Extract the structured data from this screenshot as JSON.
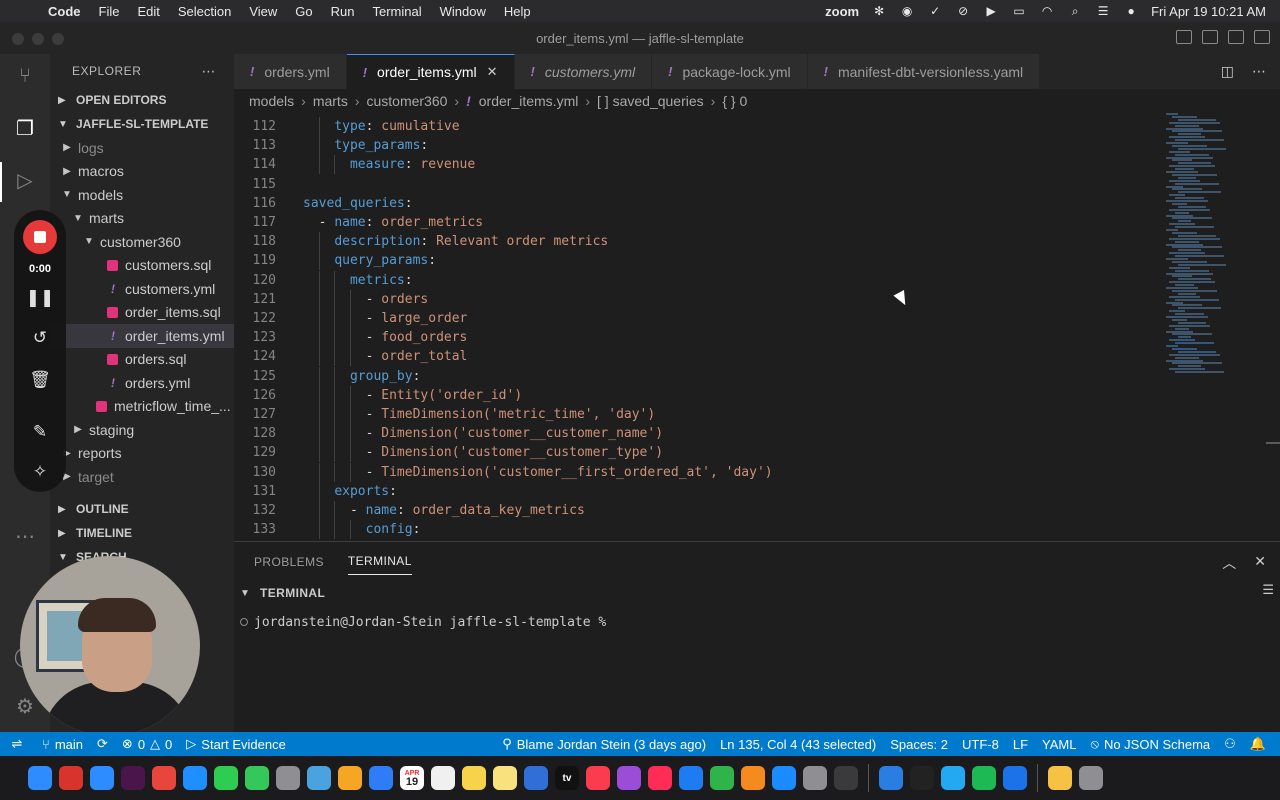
{
  "menubar": {
    "app": "Code",
    "items": [
      "File",
      "Edit",
      "Selection",
      "View",
      "Go",
      "Run",
      "Terminal",
      "Window",
      "Help"
    ],
    "zoom_label": "zoom",
    "datetime": "Fri Apr 19  10:21 AM"
  },
  "window": {
    "title": "order_items.yml — jaffle-sl-template"
  },
  "explorer": {
    "header": "EXPLORER",
    "open_editors": "OPEN EDITORS",
    "project": "JAFFLE-SL-TEMPLATE",
    "tree": [
      {
        "label": "logs",
        "kind": "folder",
        "state": "collapsed",
        "depth": 1,
        "dim": true
      },
      {
        "label": "macros",
        "kind": "folder",
        "state": "collapsed",
        "depth": 1
      },
      {
        "label": "models",
        "kind": "folder",
        "state": "expanded",
        "depth": 1
      },
      {
        "label": "marts",
        "kind": "folder",
        "state": "expanded",
        "depth": 2
      },
      {
        "label": "customer360",
        "kind": "folder",
        "state": "expanded",
        "depth": 3
      },
      {
        "label": "customers.sql",
        "kind": "sql",
        "depth": 4
      },
      {
        "label": "customers.yml",
        "kind": "yml",
        "depth": 4
      },
      {
        "label": "order_items.sql",
        "kind": "sql",
        "depth": 4
      },
      {
        "label": "order_items.yml",
        "kind": "yml",
        "depth": 4,
        "selected": true
      },
      {
        "label": "orders.sql",
        "kind": "sql",
        "depth": 4
      },
      {
        "label": "orders.yml",
        "kind": "yml",
        "depth": 4
      },
      {
        "label": "metricflow_time_...",
        "kind": "sql",
        "depth": 3
      },
      {
        "label": "staging",
        "kind": "folder",
        "state": "collapsed",
        "depth": 2
      },
      {
        "label": "reports",
        "kind": "folder",
        "state": "collapsed",
        "depth": 1
      },
      {
        "label": "target",
        "kind": "folder",
        "state": "collapsed",
        "depth": 1,
        "dim": true
      }
    ],
    "outline": "OUTLINE",
    "timeline": "TIMELINE",
    "search": "SEARCH"
  },
  "tabs": [
    {
      "label": "orders.yml",
      "active": false,
      "italic": false
    },
    {
      "label": "order_items.yml",
      "active": true,
      "italic": false
    },
    {
      "label": "customers.yml",
      "active": false,
      "italic": true
    },
    {
      "label": "package-lock.yml",
      "active": false,
      "italic": false
    },
    {
      "label": "manifest-dbt-versionless.yaml",
      "active": false,
      "italic": false
    }
  ],
  "breadcrumb": [
    "models",
    "marts",
    "customer360",
    "order_items.yml",
    "[ ] saved_queries",
    "{ } 0"
  ],
  "editor": {
    "lines": [
      {
        "n": "112",
        "indent": 4,
        "parts": [
          [
            "k",
            "type"
          ],
          [
            "p",
            ": "
          ],
          [
            "s",
            "cumulative"
          ]
        ]
      },
      {
        "n": "113",
        "indent": 4,
        "parts": [
          [
            "k",
            "type_params"
          ],
          [
            "p",
            ":"
          ]
        ]
      },
      {
        "n": "114",
        "indent": 6,
        "parts": [
          [
            "k",
            "measure"
          ],
          [
            "p",
            ": "
          ],
          [
            "s",
            "revenue"
          ]
        ]
      },
      {
        "n": "115",
        "indent": 0,
        "parts": []
      },
      {
        "n": "116",
        "indent": 0,
        "parts": [
          [
            "k",
            "saved_queries"
          ],
          [
            "p",
            ":"
          ]
        ]
      },
      {
        "n": "117",
        "indent": 2,
        "parts": [
          [
            "p",
            "- "
          ],
          [
            "k",
            "name"
          ],
          [
            "p",
            ": "
          ],
          [
            "s",
            "order_metrics"
          ]
        ]
      },
      {
        "n": "118",
        "indent": 4,
        "parts": [
          [
            "k",
            "description"
          ],
          [
            "p",
            ": "
          ],
          [
            "s",
            "Relevant order metrics"
          ]
        ]
      },
      {
        "n": "119",
        "indent": 4,
        "parts": [
          [
            "k",
            "query_params"
          ],
          [
            "p",
            ":"
          ]
        ]
      },
      {
        "n": "120",
        "indent": 6,
        "parts": [
          [
            "k",
            "metrics"
          ],
          [
            "p",
            ":"
          ]
        ]
      },
      {
        "n": "121",
        "indent": 8,
        "parts": [
          [
            "p",
            "- "
          ],
          [
            "s",
            "orders"
          ]
        ]
      },
      {
        "n": "122",
        "indent": 8,
        "parts": [
          [
            "p",
            "- "
          ],
          [
            "s",
            "large_order"
          ]
        ]
      },
      {
        "n": "123",
        "indent": 8,
        "parts": [
          [
            "p",
            "- "
          ],
          [
            "s",
            "food_orders"
          ]
        ]
      },
      {
        "n": "124",
        "indent": 8,
        "parts": [
          [
            "p",
            "- "
          ],
          [
            "s",
            "order_total"
          ]
        ]
      },
      {
        "n": "125",
        "indent": 6,
        "parts": [
          [
            "k",
            "group_by"
          ],
          [
            "p",
            ":"
          ]
        ]
      },
      {
        "n": "126",
        "indent": 8,
        "parts": [
          [
            "p",
            "- "
          ],
          [
            "s",
            "Entity('order_id')"
          ]
        ]
      },
      {
        "n": "127",
        "indent": 8,
        "parts": [
          [
            "p",
            "- "
          ],
          [
            "s",
            "TimeDimension('metric_time', 'day')"
          ]
        ]
      },
      {
        "n": "128",
        "indent": 8,
        "parts": [
          [
            "p",
            "- "
          ],
          [
            "s",
            "Dimension('customer__customer_name')"
          ]
        ]
      },
      {
        "n": "129",
        "indent": 8,
        "parts": [
          [
            "p",
            "- "
          ],
          [
            "s",
            "Dimension('customer__customer_type')"
          ]
        ]
      },
      {
        "n": "130",
        "indent": 8,
        "parts": [
          [
            "p",
            "- "
          ],
          [
            "s",
            "TimeDimension('customer__first_ordered_at', 'day')"
          ]
        ]
      },
      {
        "n": "131",
        "indent": 4,
        "parts": [
          [
            "k",
            "exports"
          ],
          [
            "p",
            ":"
          ]
        ]
      },
      {
        "n": "132",
        "indent": 6,
        "parts": [
          [
            "p",
            "- "
          ],
          [
            "k",
            "name"
          ],
          [
            "p",
            ": "
          ],
          [
            "s",
            "order_data_key_metrics"
          ]
        ]
      },
      {
        "n": "133",
        "indent": 8,
        "parts": [
          [
            "k",
            "config"
          ],
          [
            "p",
            ":"
          ]
        ]
      }
    ]
  },
  "panel": {
    "tabs": [
      "PROBLEMS",
      "TERMINAL"
    ],
    "active_tab": "TERMINAL",
    "terminal_header": "TERMINAL",
    "prompt": "jordanstein@Jordan-Stein jaffle-sl-template %"
  },
  "recorder": {
    "time": "0:00"
  },
  "statusbar": {
    "branch": "main",
    "errors": "0",
    "warnings": "0",
    "start_evidence": "Start Evidence",
    "blame": "Blame Jordan Stein (3 days ago)",
    "position": "Ln 135, Col 4 (43 selected)",
    "spaces": "Spaces: 2",
    "encoding": "UTF-8",
    "eol": "LF",
    "language": "YAML",
    "schema": "No JSON Schema"
  },
  "colors": {
    "accent": "#007acc",
    "yaml_key": "#569cd6",
    "yaml_string": "#ce9178",
    "sql_icon": "#e2337a",
    "yml_icon": "#a074c4",
    "record": "#e63a3a"
  },
  "dock": {
    "icons": [
      "finder-icon",
      "x-icon",
      "zoom-icon",
      "slack-icon",
      "chrome-icon",
      "safari-icon",
      "facetime-icon",
      "messages-icon",
      "launchpad-icon",
      "maps-icon",
      "photos-icon",
      "mail-icon",
      "calendar-icon",
      "reminders-icon",
      "notes-icon",
      "stickies-icon",
      "freeform-icon",
      "tv-icon",
      "music-icon",
      "podcasts-icon",
      "news-icon",
      "keynote-icon",
      "numbers-icon",
      "pages-icon",
      "appstore-icon",
      "settings-icon",
      "help-icon",
      "bluetooth-icon",
      "terminal-icon",
      "vscode-icon",
      "spotify-icon",
      "1password-icon",
      "preview-icon",
      "trash-icon"
    ],
    "calendar_month": "APR",
    "calendar_day": "19",
    "tv_label": "tv"
  }
}
